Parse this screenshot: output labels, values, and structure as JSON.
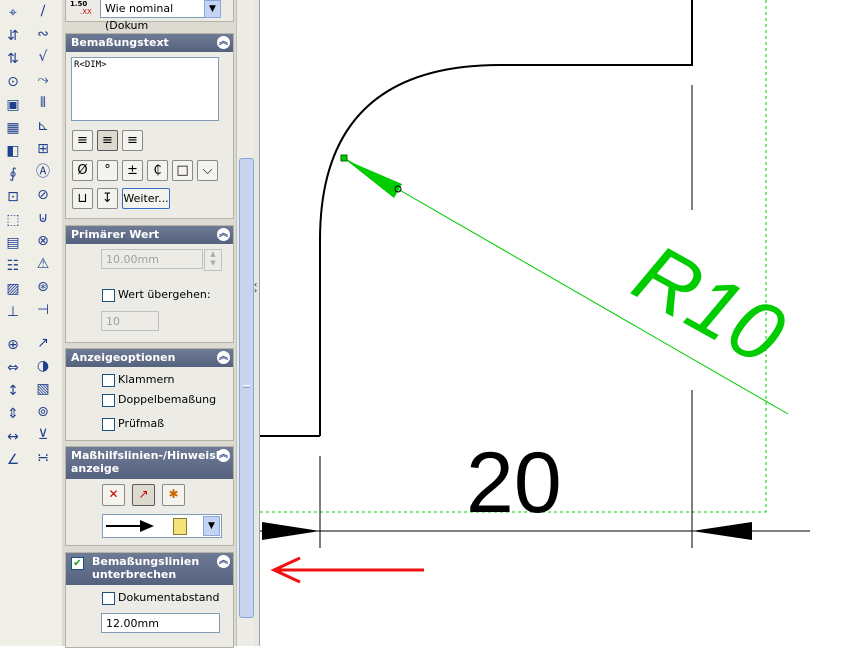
{
  "toolbar_left": {
    "icons": [
      "dimension-icon",
      "ordinate-icon",
      "baseline-icon",
      "text-icon",
      "surface-finish-icon",
      "table-icon",
      "note-icon",
      "balloon-icon",
      "datum-icon",
      "block-icon",
      "hole-callout-icon",
      "centerline-icon",
      "area-hatch-icon",
      "weld-icon",
      "geometric-tolerance-icon",
      "smart-dimension-icon",
      "horizontal-dimension-icon",
      "vertical-dimension-icon",
      "chain-dimension-icon",
      "angle-dimension-icon"
    ]
  },
  "property_manager": {
    "precision": {
      "tolerance_label_top": "1.50",
      "tolerance_label_sub": ".XX",
      "dropdown_value": "Wie nominal (Dokum"
    },
    "dimension_text": {
      "title": "Bemaßungstext",
      "text_value": "R<DIM>",
      "more_button": "Weiter...",
      "symbols": [
        "Ø",
        "°",
        "±",
        "₵",
        "□"
      ]
    },
    "primary_value": {
      "title": "Primärer Wert",
      "value": "10.00mm",
      "override_label": "Wert übergehen:",
      "override_value": "10"
    },
    "display_options": {
      "title": "Anzeigeoptionen",
      "options": [
        "Klammern",
        "Doppelbemaßung",
        "Prüfmaß"
      ]
    },
    "extension_lines": {
      "title_line1": "Maßhilfslinien-/Hinweislii",
      "title_line2": "anzeige"
    },
    "break_lines": {
      "title_line1": "Bemaßungslinien",
      "title_line2": "unterbrechen",
      "checked": true,
      "doc_gap_label": "Dokumentabstand",
      "gap_value": "12.00mm"
    }
  },
  "drawing": {
    "radius_label": "R10",
    "linear_label": "20",
    "colors": {
      "selected": "#00cc00",
      "annotation": "#ee1111",
      "geometry": "#000000"
    }
  }
}
